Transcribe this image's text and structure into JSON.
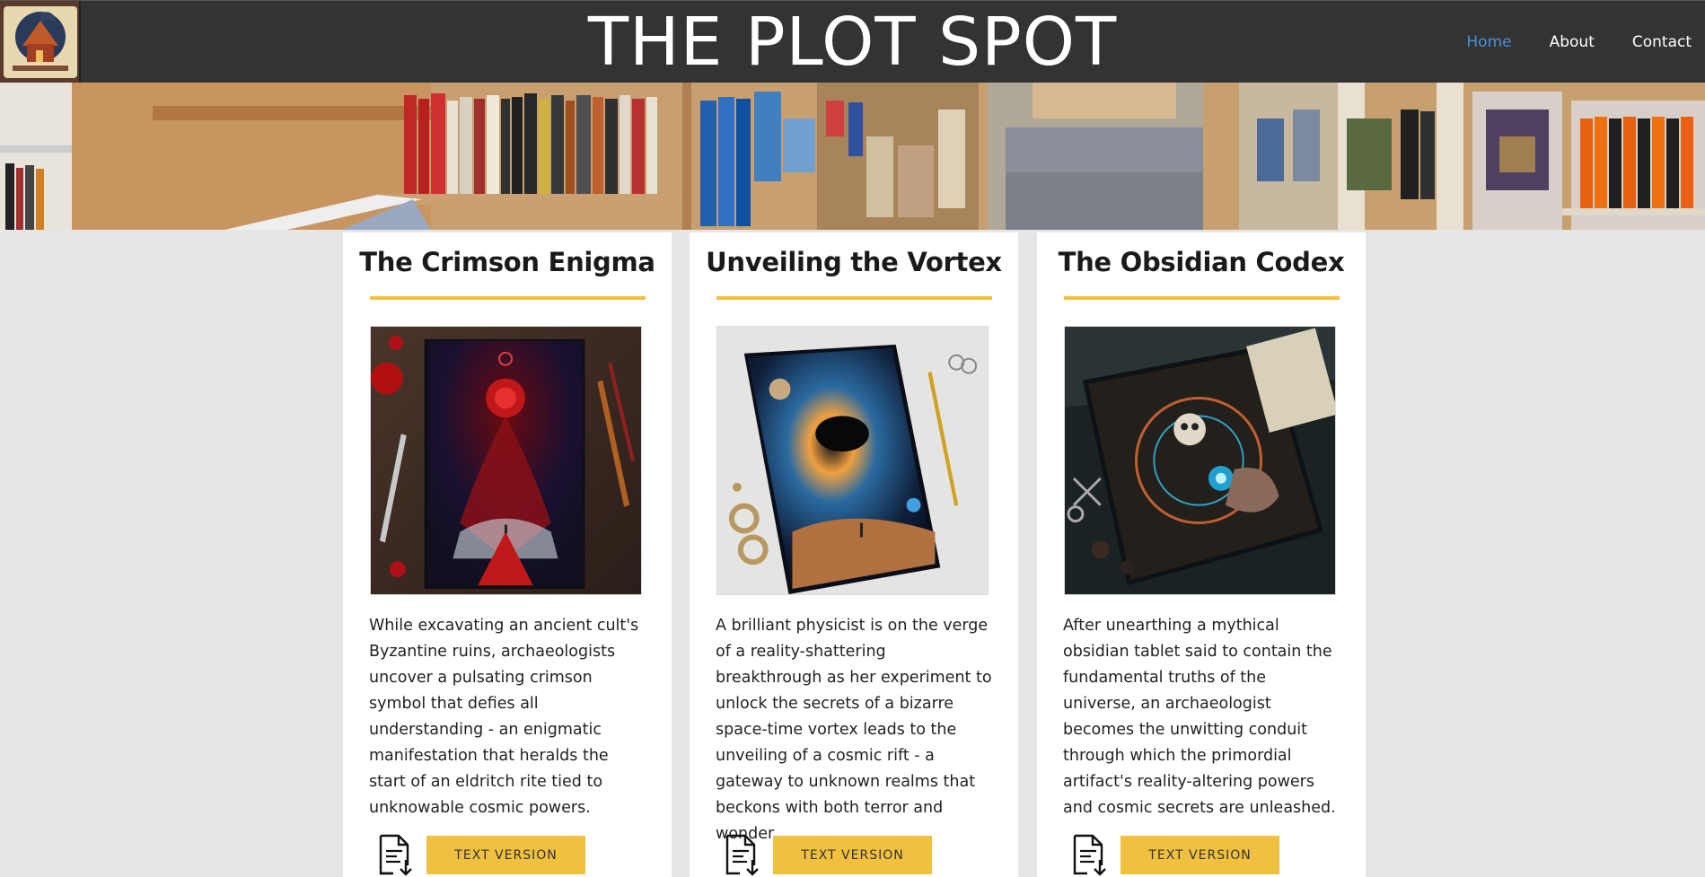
{
  "site": {
    "title": "THE PLOT SPOT",
    "nav": [
      {
        "label": "Home",
        "active": true
      },
      {
        "label": "About",
        "active": false
      },
      {
        "label": "Contact",
        "active": false
      }
    ],
    "colors": {
      "header_bg": "#333333",
      "accent": "#f0c040",
      "nav_active": "#4a90d9",
      "page_bg": "#e6e6e6"
    }
  },
  "books": [
    {
      "title": "The Crimson Enigma",
      "description": "While excavating an ancient cult's Byzantine ruins, archaeologists uncover a pulsating crimson symbol that defies all understanding - an enigmatic manifestation that heralds the start of an eldritch rite tied to unknowable cosmic powers.",
      "button": "TEXT VERSION",
      "icon": "document-download-icon"
    },
    {
      "title": "Unveiling the Vortex",
      "description": "A brilliant physicist is on the verge of a reality-shattering breakthrough as her experiment to unlock the secrets of a bizarre space-time vortex leads to the unveiling of a cosmic rift - a gateway to unknown realms that beckons with both terror and wonder.",
      "button": "TEXT VERSION",
      "icon": "document-download-icon"
    },
    {
      "title": "The Obsidian Codex",
      "description": "After unearthing a mythical obsidian tablet said to contain the fundamental truths of the universe, an archaeologist becomes the unwitting conduit through which the primordial artifact's reality-altering powers and cosmic secrets are unleashed.",
      "button": "TEXT VERSION",
      "icon": "document-download-icon"
    }
  ]
}
